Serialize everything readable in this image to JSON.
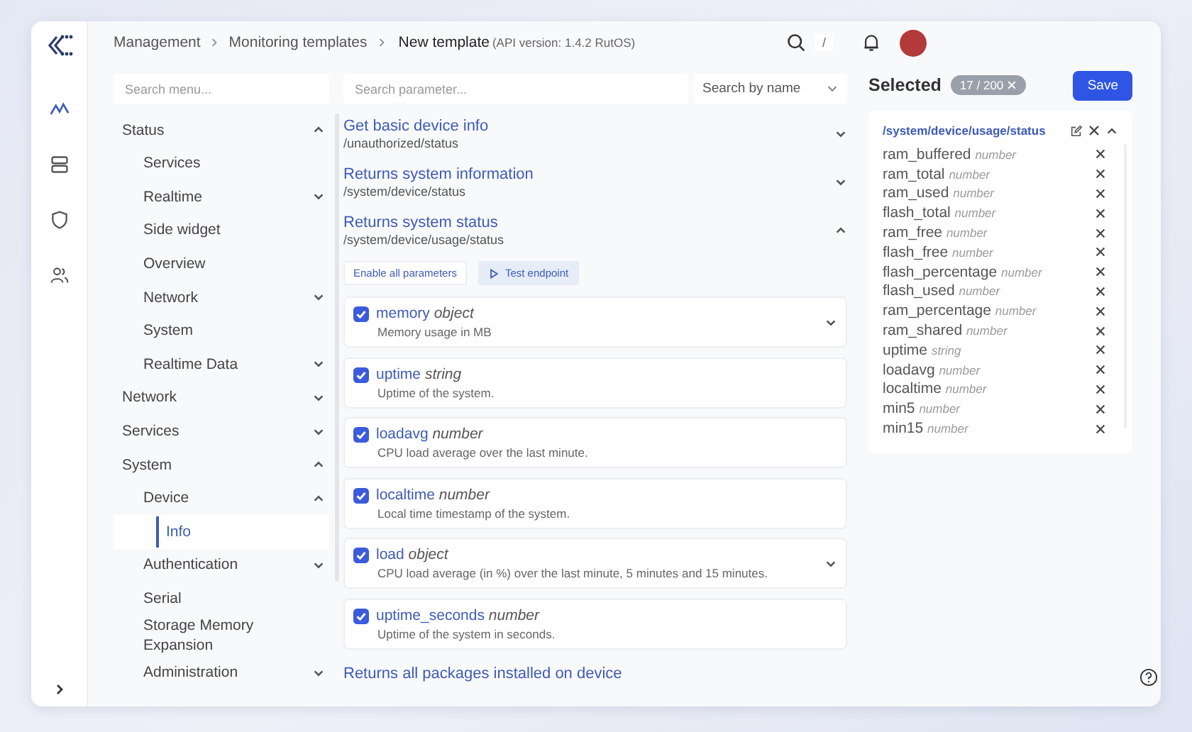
{
  "breadcrumb": [
    "Management",
    "Monitoring templates"
  ],
  "page_title": "New template",
  "api_version": "(API version: 1.4.2 RutOS)",
  "header": {
    "search_shortcut": "/"
  },
  "menu_search": {
    "placeholder": "Search menu..."
  },
  "menu": [
    {
      "label": "Status",
      "expanded": true,
      "selected": false,
      "children": [
        {
          "label": "Services",
          "selected": false
        },
        {
          "label": "Realtime",
          "expanded": false,
          "selected": false
        },
        {
          "label": "Side widget",
          "selected": false
        },
        {
          "label": "Overview",
          "selected": false
        },
        {
          "label": "Network",
          "expanded": false,
          "selected": false
        },
        {
          "label": "System",
          "selected": false
        },
        {
          "label": "Realtime Data",
          "expanded": false,
          "selected": false
        }
      ]
    },
    {
      "label": "Network",
      "expanded": false,
      "selected": false
    },
    {
      "label": "Services",
      "expanded": false,
      "selected": false
    },
    {
      "label": "System",
      "expanded": true,
      "selected": false,
      "children": [
        {
          "label": "Device",
          "expanded": true,
          "selected": false,
          "children": [
            {
              "label": "Info",
              "selected": true
            }
          ]
        },
        {
          "label": "Authentication",
          "expanded": false,
          "selected": false
        },
        {
          "label": "Serial",
          "selected": false
        },
        {
          "label": "Storage Memory Expansion",
          "selected": false
        },
        {
          "label": "Administration",
          "expanded": false,
          "selected": false
        }
      ]
    }
  ],
  "param_search": {
    "placeholder": "Search parameter..."
  },
  "search_mode": {
    "value": "Search by name"
  },
  "endpoints": [
    {
      "title": "Get basic device info",
      "path": "/unauthorized/status",
      "expanded": false
    },
    {
      "title": "Returns system information",
      "path": "/system/device/status",
      "expanded": false
    },
    {
      "title": "Returns system status",
      "path": "/system/device/usage/status",
      "expanded": true,
      "actions": [
        {
          "label": "Enable all parameters",
          "kind": "plain"
        },
        {
          "label": "Test endpoint",
          "kind": "play"
        }
      ],
      "params": [
        {
          "name": "memory",
          "type": "object",
          "description": "Memory usage in MB",
          "checked": true,
          "expandable": true
        },
        {
          "name": "uptime",
          "type": "string",
          "description": "Uptime of the system.",
          "checked": true,
          "expandable": false
        },
        {
          "name": "loadavg",
          "type": "number",
          "description": "CPU load average over the last minute.",
          "checked": true,
          "expandable": false
        },
        {
          "name": "localtime",
          "type": "number",
          "description": "Local time timestamp of the system.",
          "checked": true,
          "expandable": false
        },
        {
          "name": "load",
          "type": "object",
          "description": "CPU load average (in %) over the last minute, 5 minutes and 15 minutes.",
          "checked": true,
          "expandable": true
        },
        {
          "name": "uptime_seconds",
          "type": "number",
          "description": "Uptime of the system in seconds.",
          "checked": true,
          "expandable": false
        }
      ]
    },
    {
      "title": "Returns all packages installed on device"
    }
  ],
  "selected_panel": {
    "title": "Selected",
    "count": "17 / 200",
    "save": "Save",
    "groups": [
      {
        "path": "/system/device/usage/status",
        "expanded": true,
        "items": [
          {
            "name": "ram_buffered",
            "type": "number"
          },
          {
            "name": "ram_total",
            "type": "number"
          },
          {
            "name": "ram_used",
            "type": "number"
          },
          {
            "name": "flash_total",
            "type": "number"
          },
          {
            "name": "ram_free",
            "type": "number"
          },
          {
            "name": "flash_free",
            "type": "number"
          },
          {
            "name": "flash_percentage",
            "type": "number"
          },
          {
            "name": "flash_used",
            "type": "number"
          },
          {
            "name": "ram_percentage",
            "type": "number"
          },
          {
            "name": "ram_shared",
            "type": "number"
          },
          {
            "name": "uptime",
            "type": "string"
          },
          {
            "name": "loadavg",
            "type": "number"
          },
          {
            "name": "localtime",
            "type": "number"
          },
          {
            "name": "min5",
            "type": "number"
          },
          {
            "name": "min15",
            "type": "number"
          }
        ]
      }
    ]
  }
}
